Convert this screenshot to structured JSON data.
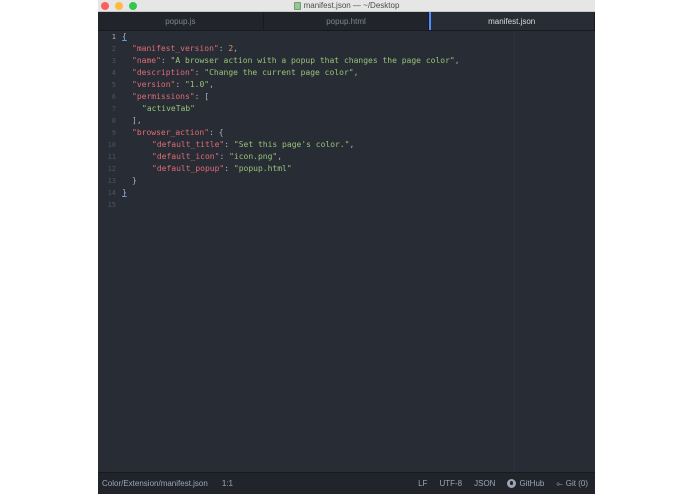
{
  "window": {
    "title": "manifest.json — ~/Desktop"
  },
  "tabs": [
    {
      "label": "popup.js"
    },
    {
      "label": "popup.html"
    },
    {
      "label": "manifest.json"
    }
  ],
  "editor": {
    "line_numbers": [
      "1",
      "2",
      "3",
      "4",
      "5",
      "6",
      "7",
      "8",
      "9",
      "10",
      "11",
      "12",
      "13",
      "14",
      "15"
    ],
    "code": {
      "open_brace": "{",
      "l2_key": "\"manifest_version\"",
      "l2_val": "2",
      "l3_key": "\"name\"",
      "l3_val": "\"A browser action with a popup that changes the page color\"",
      "l4_key": "\"description\"",
      "l4_val": "\"Change the current page color\"",
      "l5_key": "\"version\"",
      "l5_val": "\"1.0\"",
      "l6_key": "\"permissions\"",
      "l6_open": "[",
      "l7_val": "\"activeTab\"",
      "l8_close": "],",
      "l9_key": "\"browser_action\"",
      "l9_open": "{",
      "l10_key": "\"default_title\"",
      "l10_val": "\"Set this page's color.\"",
      "l11_key": "\"default_icon\"",
      "l11_val": "\"icon.png\"",
      "l12_key": "\"default_popup\"",
      "l12_val": "\"popup.html\"",
      "l13_close": "}",
      "l14_close": "}"
    }
  },
  "statusbar": {
    "file_path": "Color/Extension/manifest.json",
    "cursor": "1:1",
    "line_ending": "LF",
    "encoding": "UTF-8",
    "grammar": "JSON",
    "github": "GitHub",
    "git": "Git (0)"
  }
}
